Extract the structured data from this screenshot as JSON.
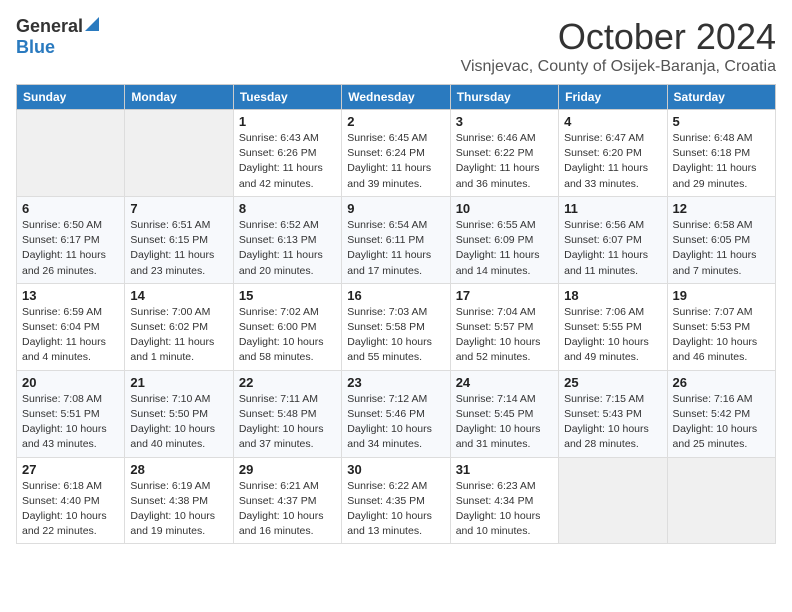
{
  "header": {
    "logo_general": "General",
    "logo_blue": "Blue",
    "month_title": "October 2024",
    "location": "Visnjevac, County of Osijek-Baranja, Croatia"
  },
  "days_of_week": [
    "Sunday",
    "Monday",
    "Tuesday",
    "Wednesday",
    "Thursday",
    "Friday",
    "Saturday"
  ],
  "weeks": [
    [
      {
        "day": "",
        "info": ""
      },
      {
        "day": "",
        "info": ""
      },
      {
        "day": "1",
        "info": "Sunrise: 6:43 AM\nSunset: 6:26 PM\nDaylight: 11 hours and 42 minutes."
      },
      {
        "day": "2",
        "info": "Sunrise: 6:45 AM\nSunset: 6:24 PM\nDaylight: 11 hours and 39 minutes."
      },
      {
        "day": "3",
        "info": "Sunrise: 6:46 AM\nSunset: 6:22 PM\nDaylight: 11 hours and 36 minutes."
      },
      {
        "day": "4",
        "info": "Sunrise: 6:47 AM\nSunset: 6:20 PM\nDaylight: 11 hours and 33 minutes."
      },
      {
        "day": "5",
        "info": "Sunrise: 6:48 AM\nSunset: 6:18 PM\nDaylight: 11 hours and 29 minutes."
      }
    ],
    [
      {
        "day": "6",
        "info": "Sunrise: 6:50 AM\nSunset: 6:17 PM\nDaylight: 11 hours and 26 minutes."
      },
      {
        "day": "7",
        "info": "Sunrise: 6:51 AM\nSunset: 6:15 PM\nDaylight: 11 hours and 23 minutes."
      },
      {
        "day": "8",
        "info": "Sunrise: 6:52 AM\nSunset: 6:13 PM\nDaylight: 11 hours and 20 minutes."
      },
      {
        "day": "9",
        "info": "Sunrise: 6:54 AM\nSunset: 6:11 PM\nDaylight: 11 hours and 17 minutes."
      },
      {
        "day": "10",
        "info": "Sunrise: 6:55 AM\nSunset: 6:09 PM\nDaylight: 11 hours and 14 minutes."
      },
      {
        "day": "11",
        "info": "Sunrise: 6:56 AM\nSunset: 6:07 PM\nDaylight: 11 hours and 11 minutes."
      },
      {
        "day": "12",
        "info": "Sunrise: 6:58 AM\nSunset: 6:05 PM\nDaylight: 11 hours and 7 minutes."
      }
    ],
    [
      {
        "day": "13",
        "info": "Sunrise: 6:59 AM\nSunset: 6:04 PM\nDaylight: 11 hours and 4 minutes."
      },
      {
        "day": "14",
        "info": "Sunrise: 7:00 AM\nSunset: 6:02 PM\nDaylight: 11 hours and 1 minute."
      },
      {
        "day": "15",
        "info": "Sunrise: 7:02 AM\nSunset: 6:00 PM\nDaylight: 10 hours and 58 minutes."
      },
      {
        "day": "16",
        "info": "Sunrise: 7:03 AM\nSunset: 5:58 PM\nDaylight: 10 hours and 55 minutes."
      },
      {
        "day": "17",
        "info": "Sunrise: 7:04 AM\nSunset: 5:57 PM\nDaylight: 10 hours and 52 minutes."
      },
      {
        "day": "18",
        "info": "Sunrise: 7:06 AM\nSunset: 5:55 PM\nDaylight: 10 hours and 49 minutes."
      },
      {
        "day": "19",
        "info": "Sunrise: 7:07 AM\nSunset: 5:53 PM\nDaylight: 10 hours and 46 minutes."
      }
    ],
    [
      {
        "day": "20",
        "info": "Sunrise: 7:08 AM\nSunset: 5:51 PM\nDaylight: 10 hours and 43 minutes."
      },
      {
        "day": "21",
        "info": "Sunrise: 7:10 AM\nSunset: 5:50 PM\nDaylight: 10 hours and 40 minutes."
      },
      {
        "day": "22",
        "info": "Sunrise: 7:11 AM\nSunset: 5:48 PM\nDaylight: 10 hours and 37 minutes."
      },
      {
        "day": "23",
        "info": "Sunrise: 7:12 AM\nSunset: 5:46 PM\nDaylight: 10 hours and 34 minutes."
      },
      {
        "day": "24",
        "info": "Sunrise: 7:14 AM\nSunset: 5:45 PM\nDaylight: 10 hours and 31 minutes."
      },
      {
        "day": "25",
        "info": "Sunrise: 7:15 AM\nSunset: 5:43 PM\nDaylight: 10 hours and 28 minutes."
      },
      {
        "day": "26",
        "info": "Sunrise: 7:16 AM\nSunset: 5:42 PM\nDaylight: 10 hours and 25 minutes."
      }
    ],
    [
      {
        "day": "27",
        "info": "Sunrise: 6:18 AM\nSunset: 4:40 PM\nDaylight: 10 hours and 22 minutes."
      },
      {
        "day": "28",
        "info": "Sunrise: 6:19 AM\nSunset: 4:38 PM\nDaylight: 10 hours and 19 minutes."
      },
      {
        "day": "29",
        "info": "Sunrise: 6:21 AM\nSunset: 4:37 PM\nDaylight: 10 hours and 16 minutes."
      },
      {
        "day": "30",
        "info": "Sunrise: 6:22 AM\nSunset: 4:35 PM\nDaylight: 10 hours and 13 minutes."
      },
      {
        "day": "31",
        "info": "Sunrise: 6:23 AM\nSunset: 4:34 PM\nDaylight: 10 hours and 10 minutes."
      },
      {
        "day": "",
        "info": ""
      },
      {
        "day": "",
        "info": ""
      }
    ]
  ]
}
